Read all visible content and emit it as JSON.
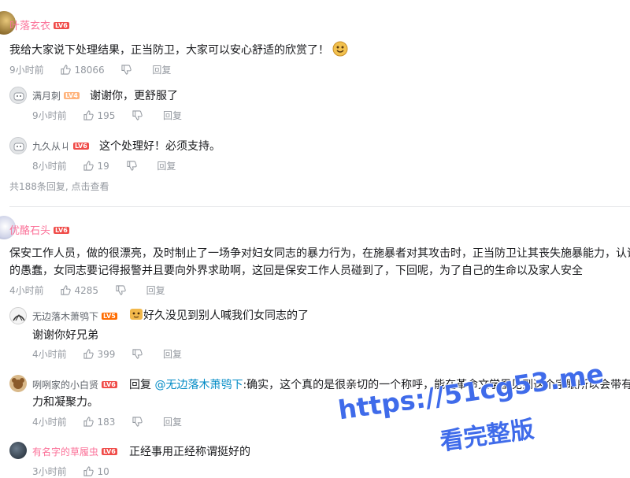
{
  "colors": {
    "accent": "#fb7299",
    "level6": "#f04c49",
    "level5": "#ff6c00",
    "level4": "#ffb37c",
    "link": "#008ac5",
    "watermark": "#3f6bea"
  },
  "actions": {
    "reply": "回复"
  },
  "comments": [
    {
      "user": "叶落玄衣",
      "level": "LV6",
      "text": "我给大家说下处理结果，正当防卫，大家可以安心舒适的欣赏了！",
      "time": "9小时前",
      "likes": "18066",
      "replies": [
        {
          "user": "满月刺",
          "level": "LV4",
          "text": "谢谢你，更舒服了",
          "time": "9小时前",
          "likes": "195"
        },
        {
          "user": "九久从ㄐ",
          "level": "LV6",
          "text": "这个处理好！必须支持。",
          "time": "8小时前",
          "likes": "19"
        }
      ],
      "reply_summary": "共188条回复, 点击查看"
    },
    {
      "user": "优酪石头",
      "level": "LV6",
      "text_line1": "保安工作人员，做的很漂亮，及时制止了一场争对妇女同志的暴力行为，在施暴者对其攻击时，正当防卫让其丧失施暴能力，认识到",
      "text_line2": "的愚蠢，女同志要记得报警并且要向外界求助啊，这回是保安工作人员碰到了，下回呢，为了自己的生命以及家人安全",
      "time": "4小时前",
      "likes": "4285",
      "replies": [
        {
          "user": "无边落木萧鸮下",
          "level": "LV5",
          "text_line1": "好久没见到别人喊我们女同志的了",
          "text_line2": "谢谢你好兄弟",
          "time": "4小时前",
          "likes": "399"
        },
        {
          "user": "咧咧家的小白贤",
          "level": "LV6",
          "reply_prefix": "回复",
          "mention": "@无边落木萧鸮下",
          "text_line1": ":确实，这个真的是很亲切的一个称呼，能在革命文学里见到这个字眼所以会带有一",
          "text_line2": "力和凝聚力。",
          "time": "4小时前",
          "likes": "183"
        },
        {
          "user": "有名字的草履虫",
          "level": "LV6",
          "text": "正经事用正经称谓挺好的",
          "time": "3小时前",
          "likes": "10"
        }
      ]
    }
  ],
  "watermark": {
    "line1": "https://51cg53.me",
    "line2": "看完整版"
  }
}
